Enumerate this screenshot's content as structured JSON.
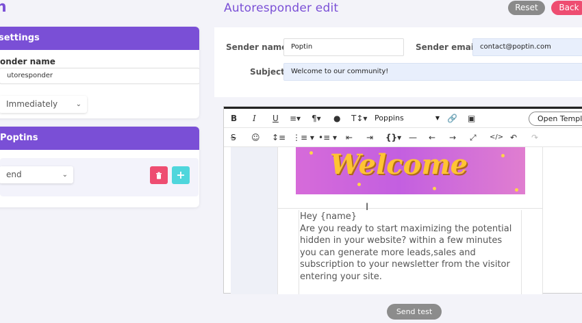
{
  "topbar": {
    "logo_text": "n",
    "title": "Autoresponder edit",
    "reset_label": "Reset",
    "back_label": "Back"
  },
  "settings": {
    "heading": "settings",
    "sender_label": "onder name",
    "sender_value": "utoresponder",
    "timing_value": "Immediately"
  },
  "poptins": {
    "heading": "Poptins",
    "action_value": "end",
    "delete_icon": "trash-icon",
    "add_icon": "plus-icon"
  },
  "email_header": {
    "sender_name_label": "Sender name",
    "sender_name_value": "Poptin",
    "sender_email_label": "Sender email",
    "sender_email_value": "contact@poptin.com",
    "subject_label": "Subject",
    "subject_value": "Welcome to our community!"
  },
  "toolbar": {
    "bold": "B",
    "italic": "I",
    "underline": "U",
    "font_name": "Poppins",
    "open_template_label": "Open Template"
  },
  "email_body": {
    "banner_text": "Welcome",
    "line1": "Hey {name}",
    "paragraph": "Are you ready to start maximizing the potential hidden in your website? within a few minutes you can generate more leads,sales and subscription to your newsletter from the visitor entering your site."
  },
  "footer": {
    "send_test_label": "Send test"
  },
  "colors": {
    "primary": "#7a4fd6",
    "danger": "#ee4d71",
    "accent": "#4fd6dc",
    "neutral": "#8a8a8a"
  }
}
